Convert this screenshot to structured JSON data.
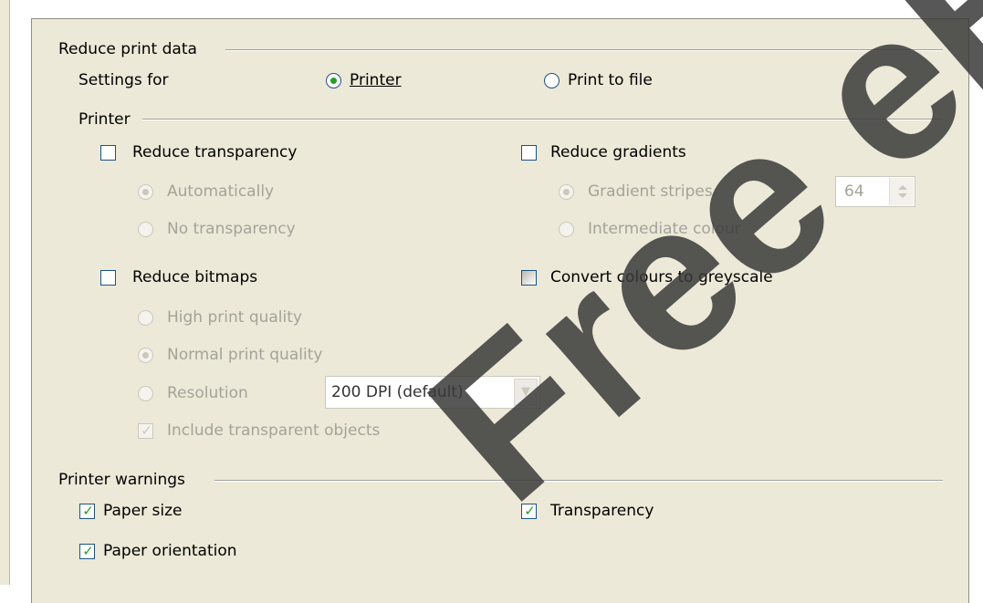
{
  "section_reduce": {
    "title": "Reduce print data"
  },
  "settings_for": {
    "label": "Settings for",
    "printer": "Printer",
    "print_to_file": "Print to file",
    "selected": "Printer"
  },
  "printer_group": {
    "title": "Printer"
  },
  "reduce_transparency": {
    "label": "Reduce transparency",
    "checked": false,
    "options": [
      "Automatically",
      "No transparency"
    ],
    "selected": "Automatically"
  },
  "reduce_gradients": {
    "label": "Reduce gradients",
    "checked": false,
    "options": [
      "Gradient stripes",
      "Intermediate colour"
    ],
    "selected": "Gradient stripes",
    "stripes_value": "64"
  },
  "reduce_bitmaps": {
    "label": "Reduce bitmaps",
    "checked": false,
    "options": [
      "High print quality",
      "Normal print quality",
      "Resolution"
    ],
    "selected": "Normal print quality",
    "resolution_value": "200 DPI (default)",
    "include_transparent": "Include transparent objects",
    "include_transparent_checked": true
  },
  "convert_greyscale": {
    "label": "Convert colours to greyscale",
    "checked": false
  },
  "printer_warnings": {
    "title": "Printer warnings",
    "paper_size": "Paper size",
    "paper_orientation": "Paper orientation",
    "transparency": "Transparency",
    "paper_size_checked": true,
    "paper_orientation_checked": true,
    "transparency_checked": true
  },
  "watermark": {
    "text": "Free eBook Edition"
  },
  "colors": {
    "dialog_bg": "#ece9d8",
    "check_green": "#21a121",
    "control_border": "#1c5180",
    "disabled_text": "#a3a39a"
  }
}
